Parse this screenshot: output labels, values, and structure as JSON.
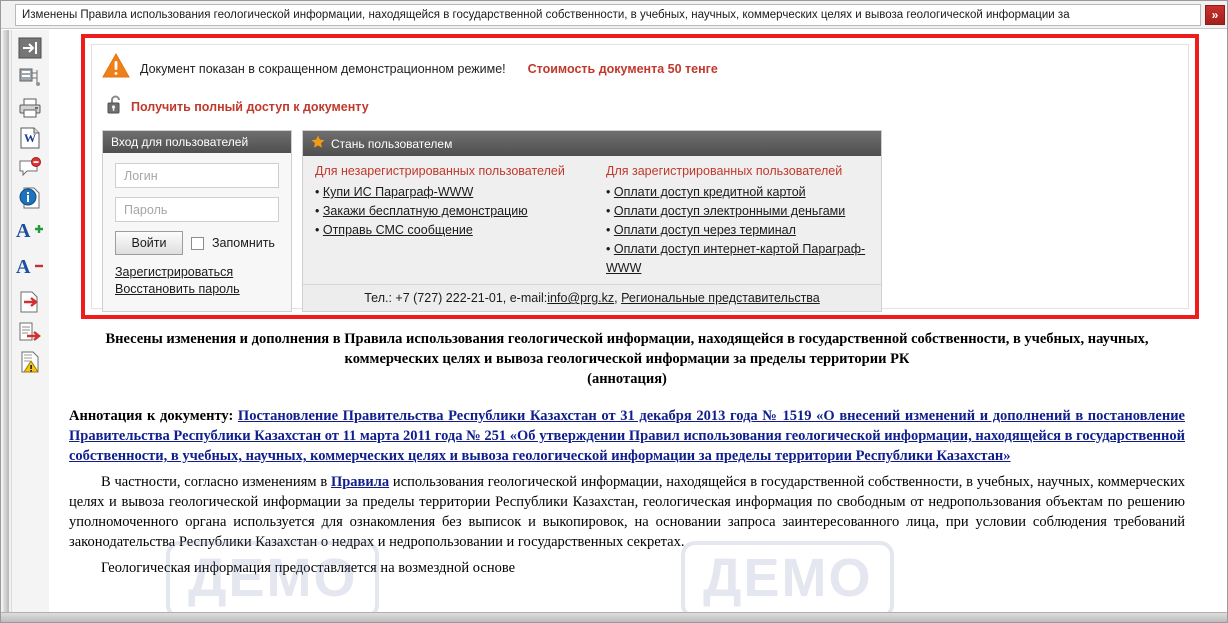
{
  "titlebar": {
    "text": "Изменены Правила использования геологической информации, находящейся в государственной собственности, в учебных, научных, коммерческих целях и вывоза геологической информации за",
    "expand_label": "»"
  },
  "toolbar": {
    "items": [
      {
        "name": "goto-icon",
        "tooltip": "Перейти"
      },
      {
        "name": "structure-icon",
        "tooltip": "Структура документа"
      },
      {
        "name": "print-icon",
        "tooltip": "Печать"
      },
      {
        "name": "word-export-icon",
        "tooltip": "Экспорт в Word"
      },
      {
        "name": "comment-icon",
        "tooltip": "Комментарий"
      },
      {
        "name": "info-icon",
        "tooltip": "Информация"
      },
      {
        "name": "font-increase-icon",
        "label": "A+"
      },
      {
        "name": "font-decrease-icon",
        "label": "A−"
      },
      {
        "name": "next-doc-icon",
        "tooltip": "Следующий документ"
      },
      {
        "name": "forward-doc-icon",
        "tooltip": "Перейти далее"
      },
      {
        "name": "warning-doc-icon",
        "tooltip": "Предупреждение"
      }
    ]
  },
  "demo": {
    "message": "Документ показан в сокращенном демонстрационном режиме!",
    "price": "Стоимость документа 50 тенге",
    "access_label": "Получить полный доступ к документу"
  },
  "login": {
    "title": "Вход для пользователей",
    "login_placeholder": "Логин",
    "login_value": "",
    "password_placeholder": "Пароль",
    "password_value": "",
    "submit_label": "Войти",
    "remember_label": "Запомнить",
    "register_label": "Зарегистрироваться",
    "restore_label": "Восстановить пароль"
  },
  "become": {
    "title": "Стань пользователем",
    "unregistered": {
      "title": "Для незарегистрированных пользователей",
      "items": [
        "Купи ИС Параграф-WWW",
        "Закажи бесплатную демонстрацию",
        "Отправь СМС сообщение"
      ]
    },
    "registered": {
      "title": "Для зарегистрированных пользователей",
      "items": [
        "Оплати доступ кредитной картой",
        "Оплати доступ электронными деньгами",
        "Оплати доступ через терминал",
        "Оплати доступ интернет-картой Параграф-WWW"
      ]
    },
    "footer": {
      "phone_prefix": "Тел.: +7 (727) 222-21-01, e-mail:",
      "email": "info@prg.kz",
      "separator": ", ",
      "regional": "Региональные представительства"
    }
  },
  "document": {
    "title": "Внесены изменения и дополнения в Правила использования геологической информации, находящейся в государственной собственности, в учебных, научных, коммерческих целях и вывоза геологической информации за пределы территории РК",
    "subtitle": "(аннотация)",
    "annotation_label": "Аннотация к документу: ",
    "annotation_link": "Постановление Правительства Республики Казахстан от 31 декабря 2013 года № 1519 «О внесений изменений и дополнений в постановление Правительства Республики Казахстан от 11 марта 2011 года № 251 «Об утверждении Правил использования геологической информации, находящейся в государственной собственности, в учебных, научных, коммерческих целях и вывоза геологической информации за пределы территории Республики Казахстан»",
    "para1_before": "В частности, согласно изменениям в ",
    "para1_link": "Правила",
    "para1_after": " использования геологической информации, находящейся в государственной собственности, в учебных, научных, коммерческих целях и вывоза геологической информации за пределы территории Республики Казахстан, геологическая информация по свободным от недропользования объектам по решению уполномоченного органа используется для ознакомления без выписок и выкопировок, на основании запроса заинтересованного лица, при условии соблюдения требований законодательства Республики Казахстан о недрах и недропользовании и государственных секретах.",
    "para2": "Геологическая информация предоставляется на возмездной основе",
    "watermark": "ДЕМО"
  },
  "colors": {
    "frame_red": "#ee1c1c",
    "accent_red": "#c0392b",
    "link_blue": "#0f1e8c",
    "panel_header": "#5a5a5a"
  }
}
